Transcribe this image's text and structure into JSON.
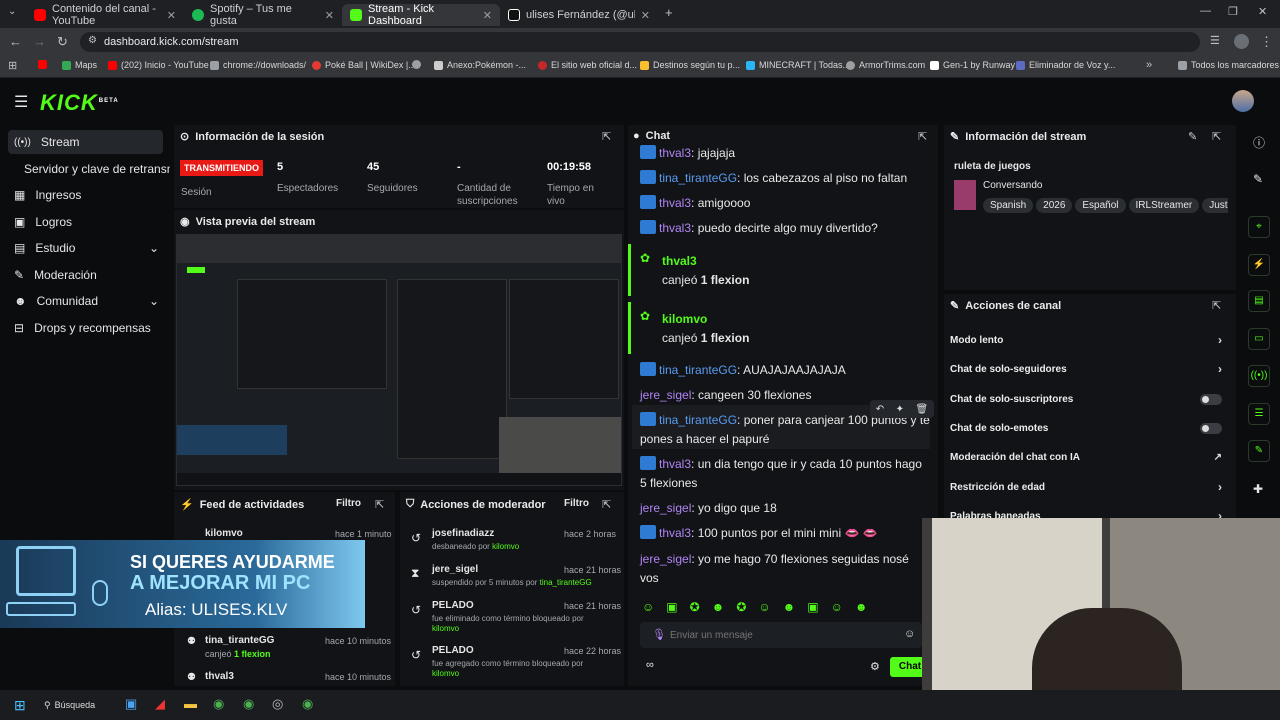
{
  "browser": {
    "tabs": [
      {
        "label": "Contenido del canal - YouTube",
        "color": "#ff0000",
        "active": false
      },
      {
        "label": "Spotify – Tus me gusta",
        "color": "#1db954",
        "active": false
      },
      {
        "label": "Stream - Kick Dashboard",
        "color": "#53fc18",
        "active": true
      },
      {
        "label": "ulises Fernández (@ulises.klv) |",
        "color": "#ffffff",
        "active": false
      }
    ],
    "url": "dashboard.kick.com/stream",
    "bookmarks": [
      {
        "label": "",
        "color": "#ff0000"
      },
      {
        "label": "Maps",
        "color": "#34a853"
      },
      {
        "label": "(202) Inicio - YouTube",
        "color": "#ff0000"
      },
      {
        "label": "chrome://downloads/",
        "color": "#9aa0a6"
      },
      {
        "label": "Poké Ball | WikiDex |...",
        "color": "#e53935"
      },
      {
        "label": "",
        "color": "#9aa0a6"
      },
      {
        "label": "Anexo:Pokémon -...",
        "color": "#cccccc"
      },
      {
        "label": "El sitio web oficial d...",
        "color": "#c62828"
      },
      {
        "label": "Destinos según tu p...",
        "color": "#fbc02d"
      },
      {
        "label": "MINECRAFT | Todas...",
        "color": "#29b6f6"
      },
      {
        "label": "ArmorTrims.com",
        "color": "#9e9e9e"
      },
      {
        "label": "Gen-1 by Runway",
        "color": "#ffffff"
      },
      {
        "label": "Eliminador de Voz y...",
        "color": "#5c6bc0"
      }
    ],
    "all_bookmarks": "Todos los marcadores"
  },
  "app": {
    "logo": "KICK",
    "logo_beta": "BETA",
    "brand_color": "#53fc18"
  },
  "sidebar": {
    "items": [
      {
        "label": "Stream",
        "icon": "broadcast-icon"
      },
      {
        "label": "Servidor y clave de retransmisión",
        "icon": ""
      },
      {
        "label": "Ingresos",
        "icon": "revenue-icon"
      },
      {
        "label": "Logros",
        "icon": "achievements-icon"
      },
      {
        "label": "Estudio",
        "icon": "studio-icon"
      },
      {
        "label": "Moderación",
        "icon": "moderation-icon"
      },
      {
        "label": "Comunidad",
        "icon": "community-icon"
      },
      {
        "label": "Drops y recompensas",
        "icon": "drops-icon"
      }
    ]
  },
  "session": {
    "title": "Información de la sesión",
    "status": "TRANSMITIENDO",
    "status_label": "Sesión",
    "stats": [
      {
        "value": "5",
        "label": "Espectadores"
      },
      {
        "value": "45",
        "label": "Seguidores"
      },
      {
        "value": "-",
        "label": "Cantidad de suscripciones"
      },
      {
        "value": "00:19:58",
        "label": "Tiempo en vivo"
      }
    ]
  },
  "preview": {
    "title": "Vista previa del stream"
  },
  "overlay": {
    "line1": "SI QUERES AYUDARME",
    "line2": "A MEJORAR MI PC",
    "line3": "Alias: ULISES.KLV"
  },
  "feed": {
    "title": "Feed de actividades",
    "filter": "Filtro",
    "items": [
      {
        "user": "kilomvo",
        "action": "",
        "time": "hace 1 minuto"
      },
      {
        "user": "tina_tiranteGG",
        "action": "canjeó",
        "highlight": "1 flexion",
        "time": "hace 10 minutos"
      },
      {
        "user": "thval3",
        "action": "",
        "time": "hace 10 minutos"
      }
    ]
  },
  "modactions": {
    "title": "Acciones de moderador",
    "filter": "Filtro",
    "items": [
      {
        "user": "josefinadiazz",
        "desc": "desbaneado por",
        "by": "kilomvo",
        "time": "hace 2 horas"
      },
      {
        "user": "jere_sigel",
        "desc": "suspendido por 5 minutos por",
        "by": "tina_tiranteGG",
        "time": "hace 21 horas"
      },
      {
        "user": "PELADO",
        "desc": "fue eliminado como término bloqueado por",
        "by": "kilomvo",
        "time": "hace 21 horas"
      },
      {
        "user": "PELADO",
        "desc": "fue agregado como término bloqueado por",
        "by": "kilomvo",
        "time": "hace 22 horas"
      }
    ]
  },
  "chat": {
    "title": "Chat",
    "input_placeholder": "Enviar un mensaje",
    "send_label": "Chat",
    "messages": [
      {
        "user": "thval3",
        "color": "purple",
        "text": "jajajaja"
      },
      {
        "user": "tina_tiranteGG",
        "color": "blue",
        "text": "los cabezazos al piso no faltan"
      },
      {
        "user": "thval3",
        "color": "purple",
        "text": "amigoooo"
      },
      {
        "user": "thval3",
        "color": "purple",
        "text": "puedo decirte algo muy divertido?"
      },
      {
        "user": "tina_tiranteGG",
        "color": "blue",
        "text": "AUAJAJAAJAJAJA"
      },
      {
        "user": "jere_sigel",
        "color": "purple",
        "text": "cangeen 30 flexiones"
      },
      {
        "user": "tina_tiranteGG",
        "color": "blue",
        "text": "poner para canjear 100 puntos y te pones a hacer el papuré"
      },
      {
        "user": "thval3",
        "color": "purple",
        "text": "un dia tengo que ir y cada 10 puntos hago 5 flexiones"
      },
      {
        "user": "jere_sigel",
        "color": "purple",
        "text": "yo digo que 18"
      },
      {
        "user": "thval3",
        "color": "purple",
        "text": "100 puntos por el mini mini 👄 👄"
      },
      {
        "user": "jere_sigel",
        "color": "purple",
        "text": "yo me hago 70 flexiones seguidas nosé vos"
      }
    ],
    "redeems": [
      {
        "user": "thval3",
        "action": "canjeó",
        "reward": "1 flexion"
      },
      {
        "user": "kilomvo",
        "action": "canjeó",
        "reward": "1 flexion"
      }
    ]
  },
  "streaminfo": {
    "title": "Información del stream",
    "stream_title": "ruleta de juegos",
    "category": "Conversando",
    "tags": [
      "Spanish",
      "2026",
      "Español",
      "IRLStreamer",
      "JustC"
    ]
  },
  "channel": {
    "title": "Acciones de canal",
    "rows": [
      {
        "label": "Modo lento",
        "control": "chevron"
      },
      {
        "label": "Chat de solo-seguidores",
        "control": "chevron"
      },
      {
        "label": "Chat de solo-suscriptores",
        "control": "toggle"
      },
      {
        "label": "Chat de solo-emotes",
        "control": "toggle"
      },
      {
        "label": "Moderación del chat con IA",
        "control": "external"
      },
      {
        "label": "Restricción de edad",
        "control": "chevron"
      },
      {
        "label": "Palabras baneadas",
        "control": "chevron"
      }
    ]
  },
  "taskbar": {
    "search": "Búsqueda"
  }
}
